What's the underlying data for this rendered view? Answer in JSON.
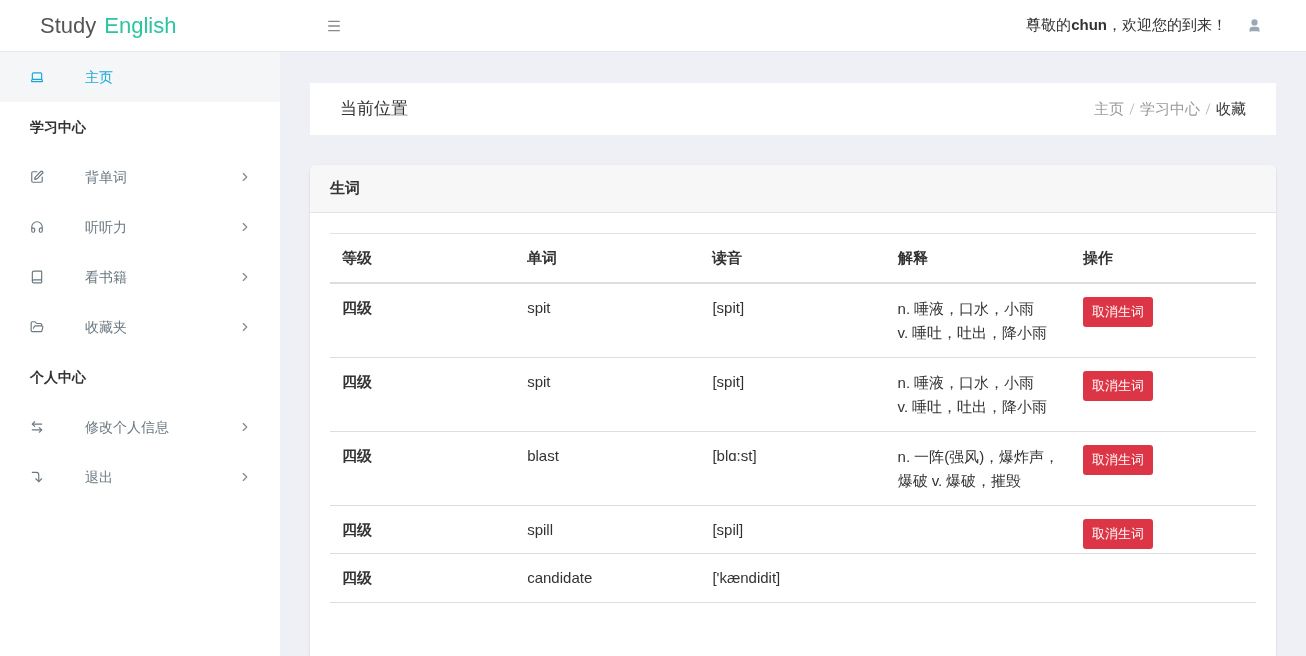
{
  "header": {
    "logo": [
      "Study",
      "English"
    ],
    "welcome": "尊敬的**chun**，欢迎您的到来！"
  },
  "sidebar": {
    "items": [
      {
        "kind": "link",
        "label": "主页",
        "selected": true
      },
      {
        "kind": "heading",
        "label": "学习中心"
      },
      {
        "kind": "link",
        "label": "背单词",
        "selected": false
      },
      {
        "kind": "link",
        "label": "听听力",
        "selected": false
      },
      {
        "kind": "link",
        "label": "看书籍",
        "selected": false
      },
      {
        "kind": "link",
        "label": "收藏夹",
        "selected": false
      },
      {
        "kind": "heading",
        "label": "个人中心"
      },
      {
        "kind": "link",
        "label": "修改个人信息",
        "selected": false
      },
      {
        "kind": "link",
        "label": "退出",
        "selected": false
      }
    ]
  },
  "location": {
    "title": "当前位置",
    "breadcrumb": [
      "主页",
      "学习中心",
      "收藏"
    ]
  },
  "card": {
    "title": "生词",
    "table": {
      "columns": [
        "等级",
        "单词",
        "读音",
        "解释",
        "操作"
      ],
      "rows": [
        {
          "level": "四级",
          "word": "spit",
          "phonetic": "[spit]",
          "meaning": [
            "n. 唾液，口水，小雨",
            "v. 唾吐，吐出，降小雨"
          ],
          "action": "取消生词"
        },
        {
          "level": "四级",
          "word": "spit",
          "phonetic": "[spit]",
          "meaning": [
            "n. 唾液，口水，小雨",
            "v. 唾吐，吐出，降小雨"
          ],
          "action": "取消生词"
        },
        {
          "level": "四级",
          "word": "blast",
          "phonetic": "[blɑ:st]",
          "meaning": [
            "n. 一阵(强风)，爆炸声，爆破 v. 爆破，摧毁"
          ],
          "action": "取消生词"
        },
        {
          "level": "四级",
          "word": "spill",
          "phonetic": "[spil]",
          "action": "取消生词"
        },
        {
          "level": "四级",
          "word": "candidate",
          "phonetic": "['kændidit]"
        }
      ]
    }
  }
}
